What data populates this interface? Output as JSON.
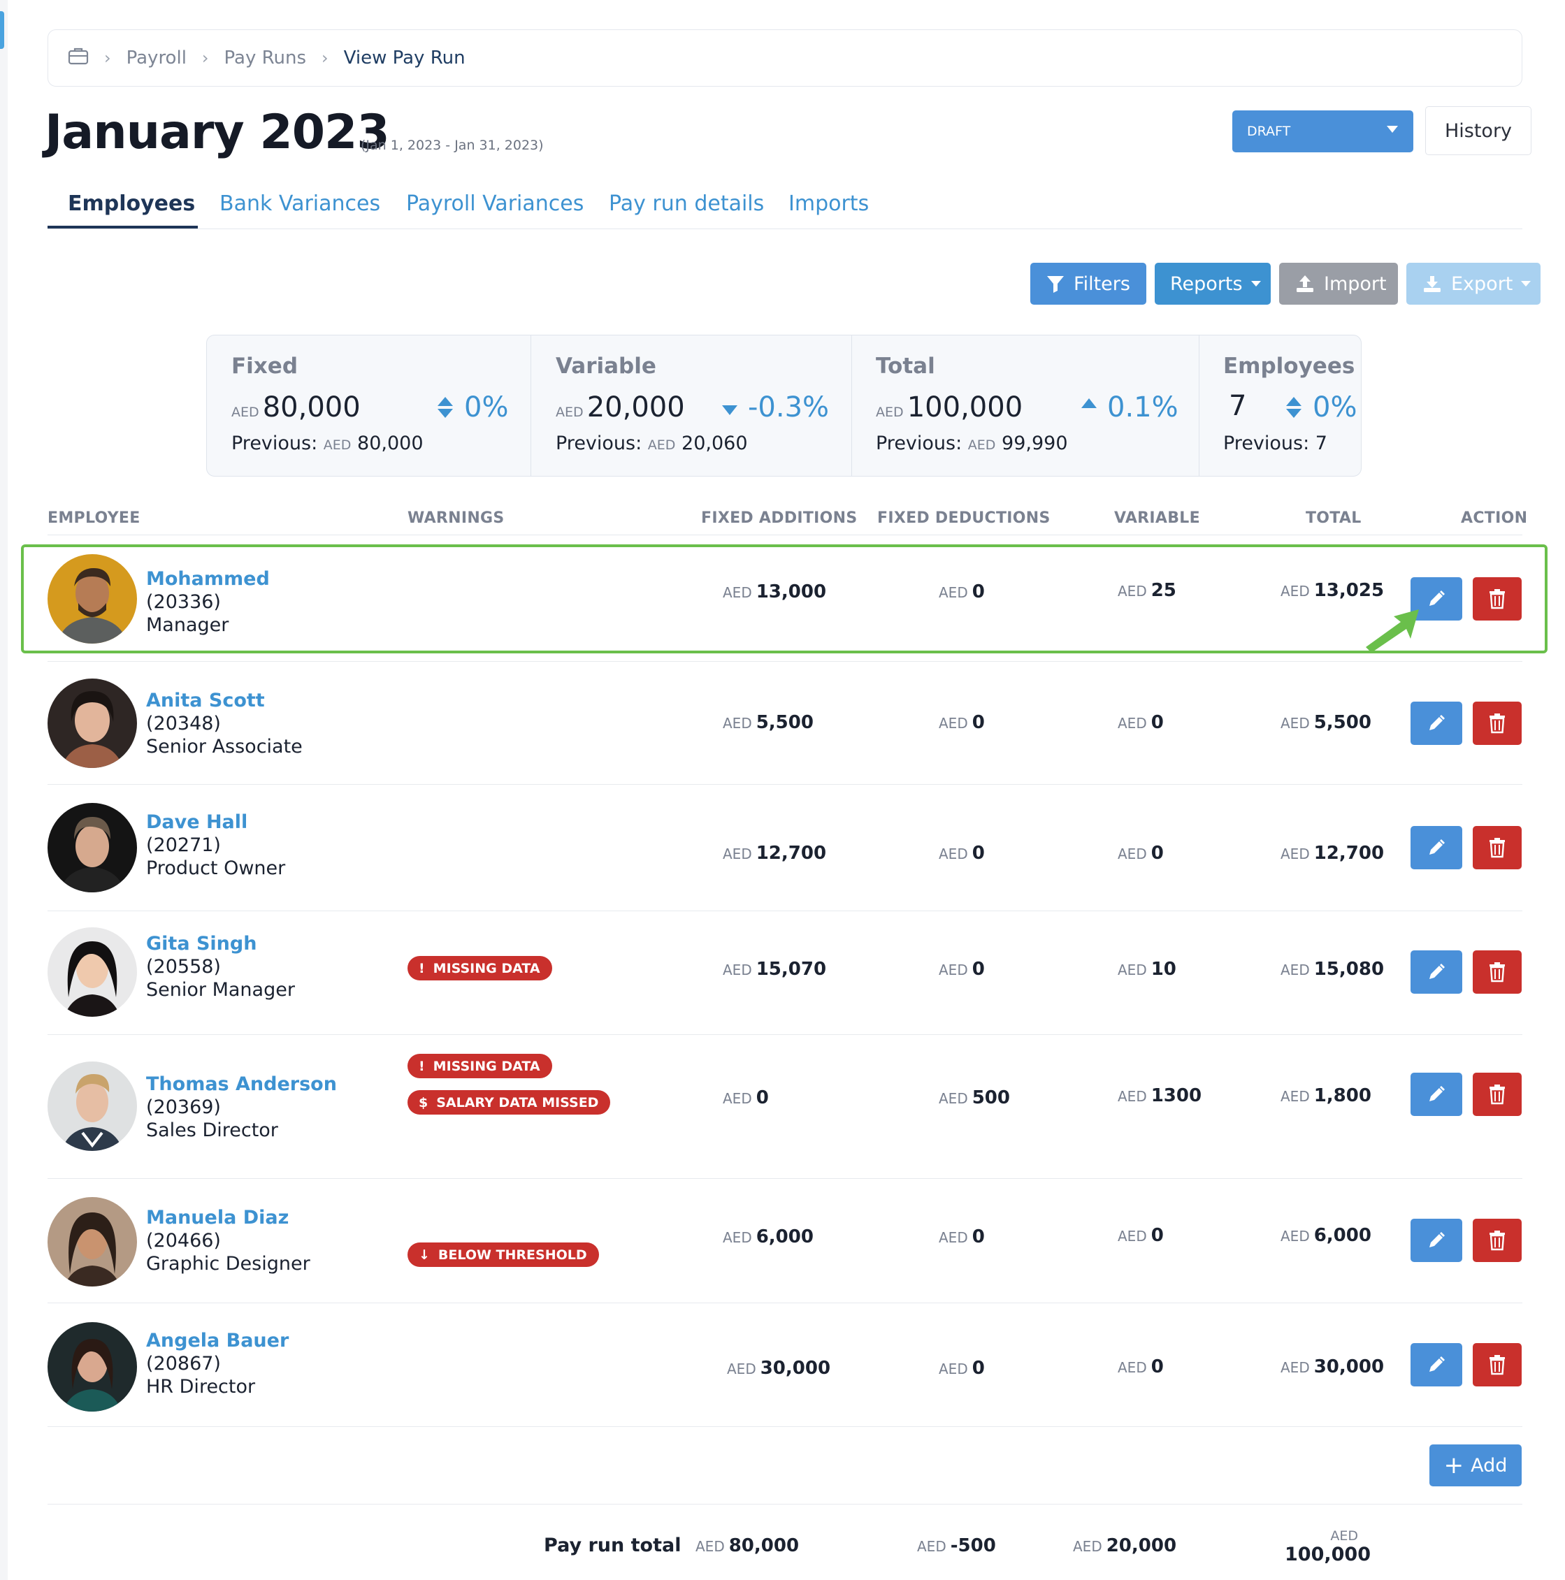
{
  "breadcrumb": {
    "items": [
      "Payroll",
      "Pay Runs"
    ],
    "current": "View Pay Run"
  },
  "page": {
    "title": "January 2023",
    "date_range": "(Jan 1, 2023 - Jan 31, 2023)"
  },
  "status": {
    "selected": "DRAFT"
  },
  "history_label": "History",
  "tabs": [
    "Employees",
    "Bank Variances",
    "Payroll Variances",
    "Pay run details",
    "Imports"
  ],
  "toolbar": {
    "filters": "Filters",
    "reports": "Reports",
    "import": "Import",
    "export": "Export"
  },
  "summary": {
    "currency": "AED",
    "previous_label": "Previous:",
    "fixed": {
      "label": "Fixed",
      "value": "80,000",
      "pct": "0%",
      "previous": "80,000"
    },
    "variable": {
      "label": "Variable",
      "value": "20,000",
      "pct": "-0.3%",
      "previous": "20,060"
    },
    "total": {
      "label": "Total",
      "value": "100,000",
      "pct": "0.1%",
      "previous": "99,990"
    },
    "employees": {
      "label": "Employees",
      "value": "7",
      "pct": "0%",
      "previous": "7"
    }
  },
  "table": {
    "headers": [
      "EMPLOYEE",
      "WARNINGS",
      "FIXED ADDITIONS",
      "FIXED DEDUCTIONS",
      "VARIABLE",
      "TOTAL",
      "ACTION"
    ],
    "rows": [
      {
        "name": "Mohammed",
        "id": "(20336)",
        "role": "Manager",
        "fixed_add": "13,000",
        "fixed_ded": "0",
        "variable": "25",
        "total": "13,025",
        "warnings": []
      },
      {
        "name": "Anita Scott",
        "id": "(20348)",
        "role": "Senior Associate",
        "fixed_add": "5,500",
        "fixed_ded": "0",
        "variable": "0",
        "total": "5,500",
        "warnings": []
      },
      {
        "name": "Dave Hall",
        "id": "(20271)",
        "role": "Product Owner",
        "fixed_add": "12,700",
        "fixed_ded": "0",
        "variable": "0",
        "total": "12,700",
        "warnings": []
      },
      {
        "name": "Gita Singh",
        "id": "(20558)",
        "role": "Senior Manager",
        "fixed_add": "15,070",
        "fixed_ded": "0",
        "variable": "10",
        "total": "15,080",
        "warnings": [
          "MISSING DATA"
        ]
      },
      {
        "name": "Thomas Anderson",
        "id": "(20369)",
        "role": "Sales Director",
        "fixed_add": "0",
        "fixed_ded": "500",
        "variable": "1300",
        "total": "1,800",
        "warnings": [
          "MISSING DATA",
          "SALARY DATA MISSED"
        ]
      },
      {
        "name": "Manuela Diaz",
        "id": "(20466)",
        "role": "Graphic Designer",
        "fixed_add": "6,000",
        "fixed_ded": "0",
        "variable": "0",
        "total": "6,000",
        "warnings": [
          "BELOW THRESHOLD"
        ]
      },
      {
        "name": "Angela Bauer",
        "id": "(20867)",
        "role": "HR Director",
        "fixed_add": "30,000",
        "fixed_ded": "0",
        "variable": "0",
        "total": "30,000",
        "warnings": []
      }
    ]
  },
  "add_label": "Add",
  "footer": {
    "label": "Pay run total",
    "fixed_add": "80,000",
    "fixed_ded": "-500",
    "variable": "20,000",
    "total": "100,000"
  },
  "colors": {
    "primary": "#4a90d9",
    "link": "#3d92d1",
    "danger": "#c9302c",
    "highlight": "#6abf4b",
    "navy": "#1e3557"
  },
  "icons": {
    "breadcrumb_home": "briefcase-icon",
    "edit": "pencil-icon",
    "delete": "trash-icon",
    "filters": "funnel-icon",
    "import": "upload-icon",
    "export": "download-icon"
  }
}
